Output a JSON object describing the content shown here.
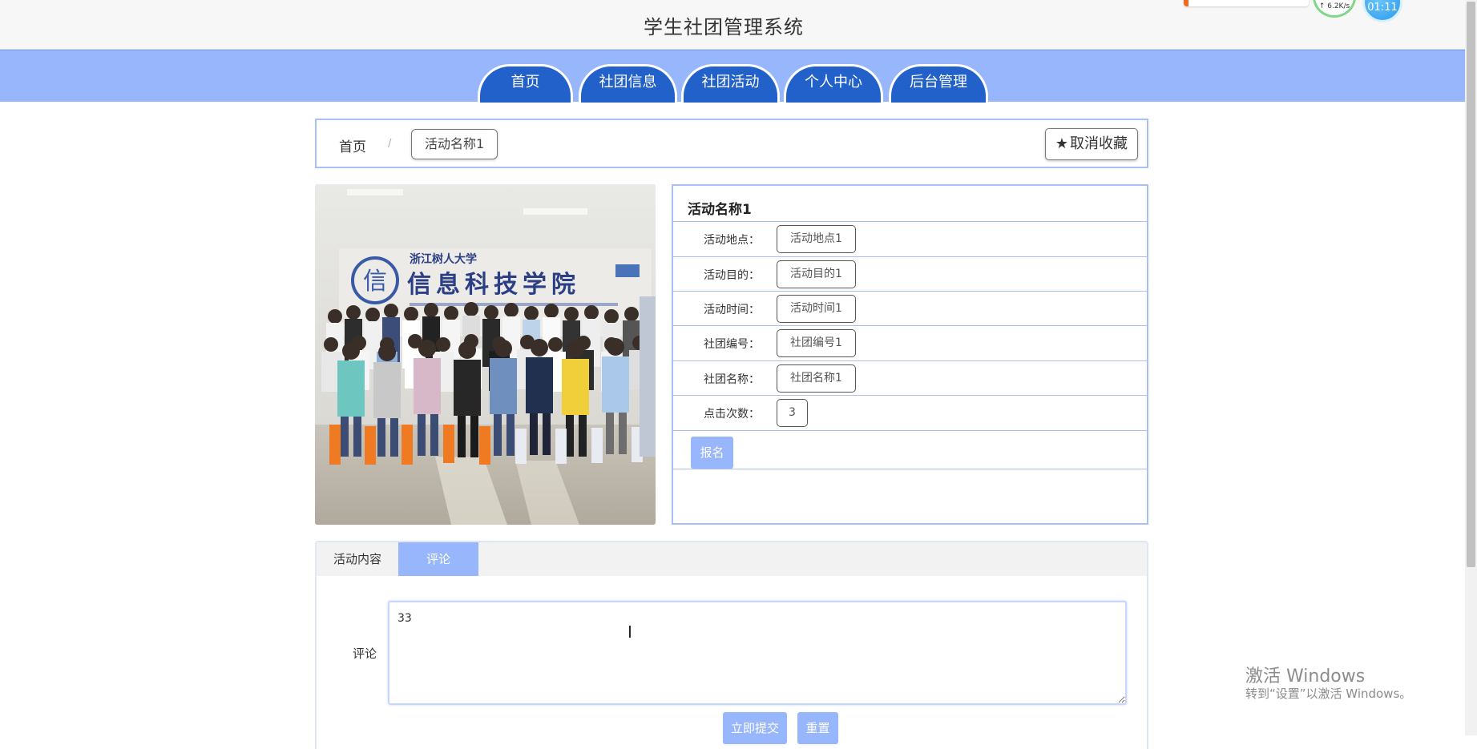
{
  "header": {
    "site_title": "学生社团管理系统",
    "tray_speed": "↑ 6.2K/s",
    "tray_clock": "01:11"
  },
  "nav": {
    "tabs": [
      {
        "label": "首页"
      },
      {
        "label": "社团信息"
      },
      {
        "label": "社团活动"
      },
      {
        "label": "个人中心"
      },
      {
        "label": "后台管理"
      }
    ]
  },
  "breadcrumb": {
    "home": "首页",
    "separator": "/",
    "current": "活动名称1"
  },
  "favorite": {
    "icon": "star-icon",
    "label": "取消收藏"
  },
  "photo": {
    "sign_line1": "浙江树人大学",
    "sign_line2": "信息科技学院"
  },
  "detail": {
    "title": "活动名称1",
    "rows": [
      {
        "label": "活动地点：",
        "value": "活动地点1"
      },
      {
        "label": "活动目的：",
        "value": "活动目的1"
      },
      {
        "label": "活动时间：",
        "value": "活动时间1"
      },
      {
        "label": "社团编号：",
        "value": "社团编号1"
      },
      {
        "label": "社团名称：",
        "value": "社团名称1"
      },
      {
        "label": "点击次数：",
        "value": "3"
      }
    ],
    "signup_label": "报名"
  },
  "tabs": {
    "content_label": "活动内容",
    "comment_label": "评论"
  },
  "comment": {
    "label": "评论",
    "value": "33",
    "submit_label": "立即提交",
    "reset_label": "重置"
  },
  "watermark": {
    "line1": "激活 Windows",
    "line2": "转到“设置”以激活 Windows。"
  },
  "colors": {
    "nav_band": "#98b6fb",
    "nav_tab": "#2161c9",
    "accent_button": "#98b6fb",
    "border": "#a9c0f6"
  }
}
